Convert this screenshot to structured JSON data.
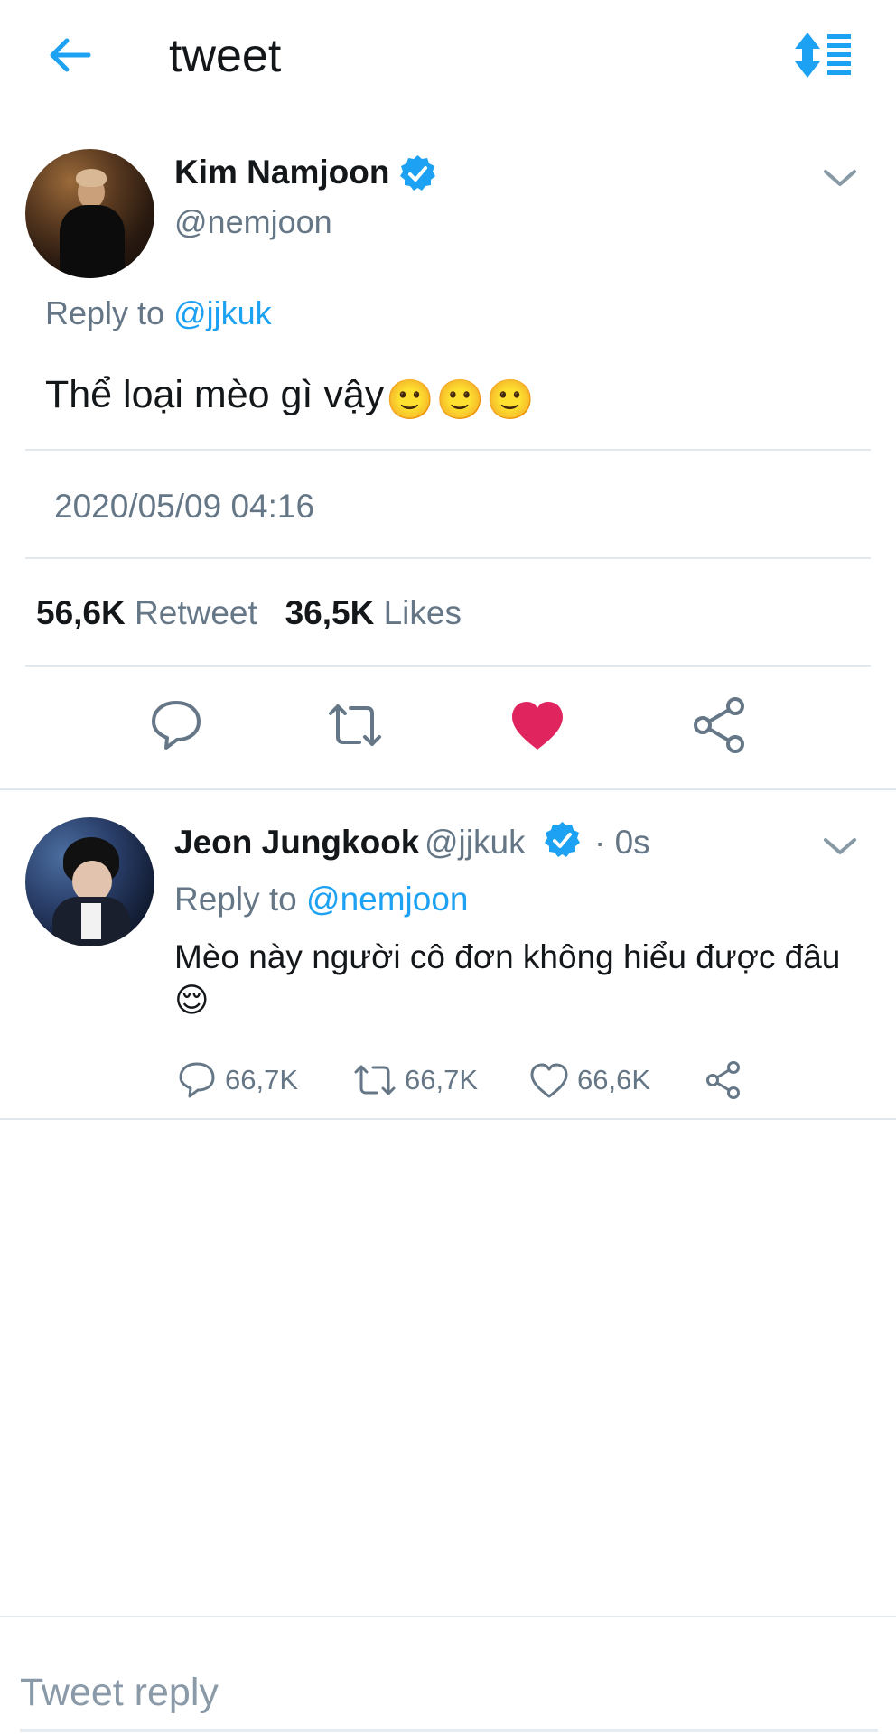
{
  "header": {
    "title": "tweet"
  },
  "main_tweet": {
    "author_name": "Kim Namjoon",
    "author_handle": "@nemjoon",
    "reply_prefix": "Reply to",
    "reply_to": "@jjkuk",
    "text": "Thể loại mèo gì vậy",
    "emoji": [
      "🙂",
      "🙂",
      "🙂"
    ],
    "timestamp": "2020/05/09 04:16",
    "retweet_count": "56,6K",
    "retweet_label": "Retweet",
    "likes_count": "36,5K",
    "likes_label": "Likes",
    "liked": true
  },
  "reply_tweet": {
    "author_name": "Jeon Jungkook",
    "author_handle": "@jjkuk",
    "time": "· 0s",
    "reply_prefix": "Reply to",
    "reply_to": "@nemjoon",
    "text": "Mèo này người cô đơn không hiểu được đâu",
    "emoji": "😌",
    "reply_count": "66,7K",
    "retweet_count": "66,7K",
    "like_count": "66,6K"
  },
  "compose": {
    "placeholder": "Tweet reply"
  },
  "colors": {
    "accent": "#1da1f2",
    "like": "#e0245e",
    "secondary_text": "#657786",
    "divider": "#e1e8ed"
  },
  "icons": {
    "back": "back-arrow-icon",
    "sort": "sort-icon",
    "verified": "verified-badge-icon",
    "chevron": "chevron-down-icon",
    "reply": "reply-icon",
    "retweet": "retweet-icon",
    "like": "heart-icon",
    "share": "share-icon"
  }
}
